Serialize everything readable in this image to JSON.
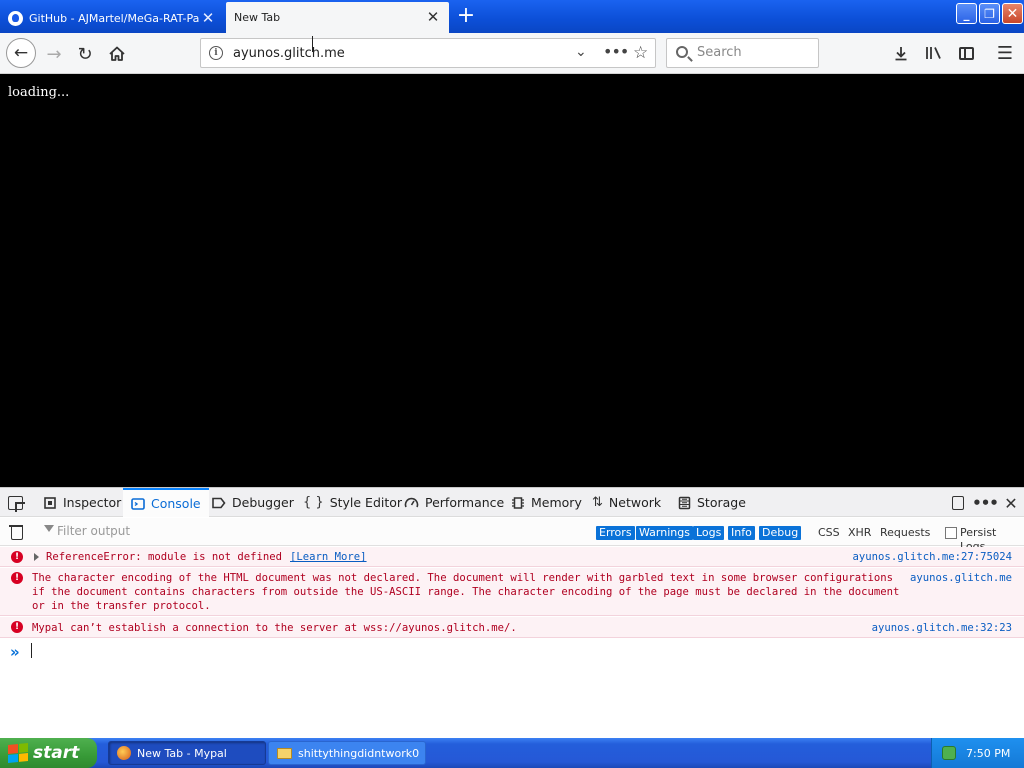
{
  "tabs": [
    {
      "label": "GitHub - AJMartel/MeGa-RAT-Pack",
      "icon": "github-icon",
      "active": false
    },
    {
      "label": "New Tab",
      "icon": "",
      "active": true
    }
  ],
  "toolbar": {
    "url": "ayunos.glitch.me",
    "search_placeholder": "Search"
  },
  "page": {
    "loading_text": "loading..."
  },
  "devtools": {
    "tabs": [
      "Inspector",
      "Console",
      "Debugger",
      "Style Editor",
      "Performance",
      "Memory",
      "Network",
      "Storage"
    ],
    "active_tab": "Console",
    "filter_placeholder": "Filter output",
    "levels": [
      "Errors",
      "Warnings",
      "Logs",
      "Info",
      "Debug"
    ],
    "filters": [
      "CSS",
      "XHR",
      "Requests"
    ],
    "persist_logs": "Persist Logs",
    "messages": [
      {
        "text": "ReferenceError: module is not defined",
        "link": "[Learn More]",
        "source": "ayunos.glitch.me:27:75024"
      },
      {
        "text": "The character encoding of the HTML document was not declared. The document will render with garbled text in some browser configurations if the document contains characters from outside the US-ASCII range. The character encoding of the page must be declared in the document or in the transfer protocol.",
        "source": "ayunos.glitch.me"
      },
      {
        "text": "Mypal can’t establish a connection to the server at wss://ayunos.glitch.me/.",
        "source": "ayunos.glitch.me:32:23"
      }
    ]
  },
  "taskbar": {
    "start_label": "start",
    "tasks": [
      {
        "label": "New Tab - Mypal",
        "active": true
      },
      {
        "label": "shittythingdidntwork0",
        "active": false
      }
    ],
    "clock": "7:50 PM"
  },
  "colors": {
    "accent": "#0a84ff",
    "error": "#d70022",
    "xp_blue": "#245edb",
    "start_green": "#379a37"
  }
}
